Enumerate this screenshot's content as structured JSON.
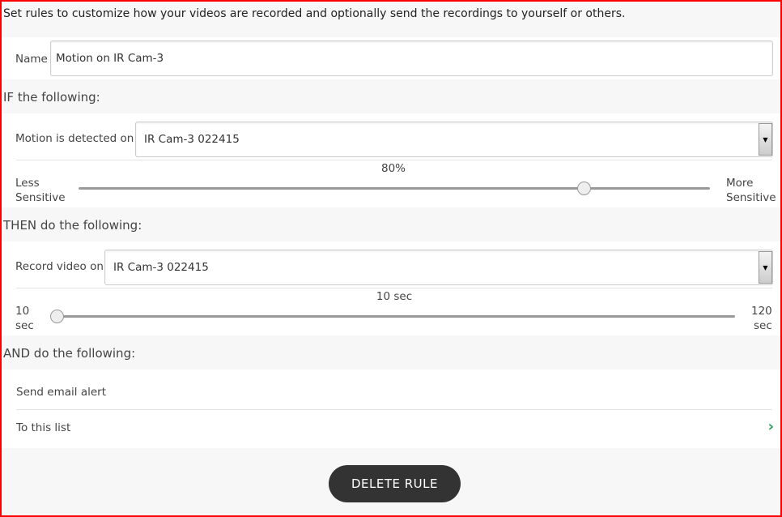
{
  "intro": "Set rules to customize how your videos are recorded and optionally send the recordings to yourself or others.",
  "name": {
    "label": "Name",
    "value": "Motion on IR Cam-3"
  },
  "if_section": {
    "title": "IF the following:",
    "motion_label": "Motion is detected on",
    "camera": "IR Cam-3 022415",
    "sensitivity": {
      "value_label": "80%",
      "value_percent": 80,
      "min_label_1": "Less",
      "min_label_2": "Sensitive",
      "max_label_1": "More",
      "max_label_2": "Sensitive"
    }
  },
  "then_section": {
    "title": "THEN do the following:",
    "record_label": "Record video on",
    "camera": "IR Cam-3 022415",
    "duration": {
      "value_label": "10 sec",
      "value": 10,
      "min": 10,
      "max": 120,
      "min_label_1": "10",
      "min_label_2": "sec",
      "max_label_1": "120",
      "max_label_2": "sec"
    }
  },
  "and_section": {
    "title": "AND do the following:",
    "email_label": "Send email alert",
    "list_label": "To this list"
  },
  "delete_label": "DELETE RULE",
  "colors": {
    "accent": "#2a9d5c",
    "button": "#333333",
    "frame": "#ff0000"
  }
}
